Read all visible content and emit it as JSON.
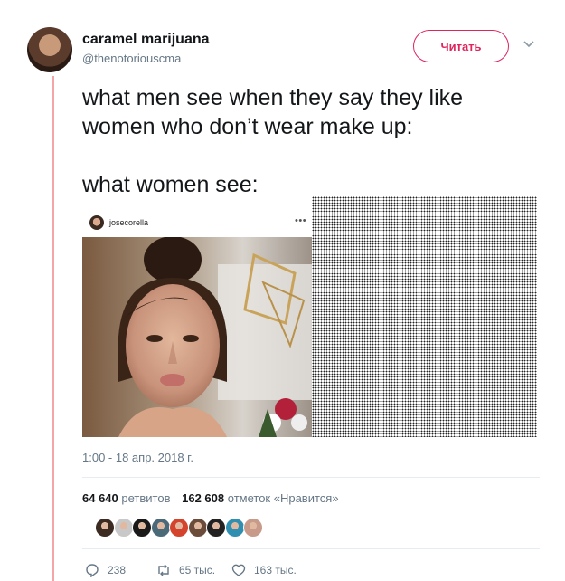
{
  "user": {
    "display_name": "caramel marijuana",
    "handle": "@thenotoriouscma",
    "follow_label": "Читать"
  },
  "tweet": {
    "line1": "what men see when they say they like",
    "line2": "women who don’t wear make up:",
    "line3": "what women see:"
  },
  "media": {
    "instagram_user": "josecorella",
    "instagram_more": "•••"
  },
  "timestamp": "1:00 - 18 апр. 2018 г.",
  "stats": {
    "retweets_count": "64 640",
    "retweets_label": "ретвитов",
    "likes_count": "162 608",
    "likes_label": "отметок «Нравится»"
  },
  "liker_colors": [
    "#3b2b22",
    "#c8c8c8",
    "#1a1a1a",
    "#4a6a7a",
    "#d4442c",
    "#6b4c3a",
    "#222222",
    "#2f8fb0",
    "#c79a8a"
  ],
  "actions": {
    "replies": "238",
    "retweets": "65 тыс.",
    "likes": "163 тыс."
  },
  "colors": {
    "accent": "#e0245e",
    "thread_line": "#f4a5a8",
    "muted": "#657786"
  }
}
